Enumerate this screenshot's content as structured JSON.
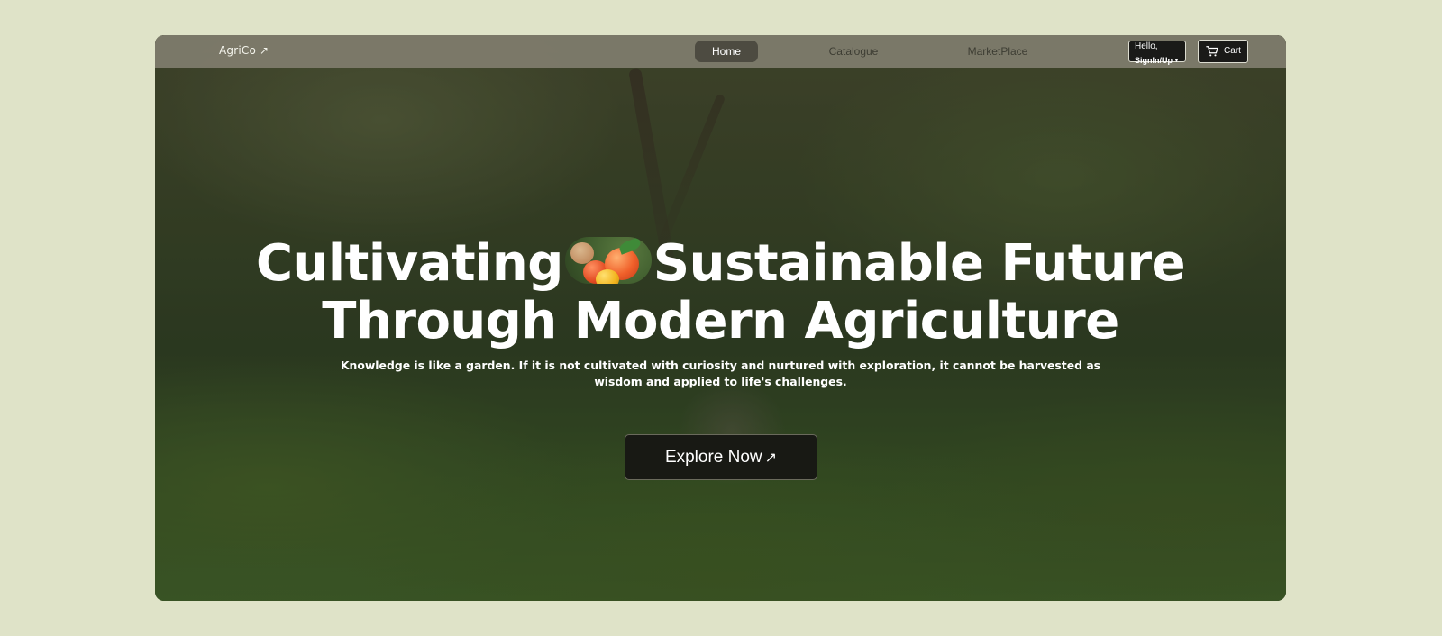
{
  "navbar": {
    "logo": "AgriCo ↗",
    "links": [
      {
        "label": "Home",
        "active": true
      },
      {
        "label": "Catalogue",
        "active": false
      },
      {
        "label": "MarketPlace",
        "active": false
      }
    ],
    "signin_greeting": "Hello,",
    "signin_label": "SignIn/Up",
    "cart_label": "Cart"
  },
  "hero": {
    "title_part1": "Cultivating",
    "title_part2": "Sustainable Future",
    "title_line2": "Through Modern Agriculture",
    "subtitle": "Knowledge is like a garden. If it is not cultivated with curiosity and nurtured with exploration, it cannot be harvested as wisdom and applied to life's challenges.",
    "cta_label": "Explore Now"
  },
  "colors": {
    "page_background": "#dfe3c8",
    "navbar_background": "#807d6e",
    "active_nav_background": "#4d4b41",
    "button_background": "#181914",
    "text_primary": "#ffffff"
  },
  "icons": {
    "logo_arrow": "arrow-up-right-icon",
    "signin_chevron": "chevron-down-icon",
    "cart": "shopping-cart-icon",
    "cta_arrow": "arrow-up-right-icon"
  }
}
